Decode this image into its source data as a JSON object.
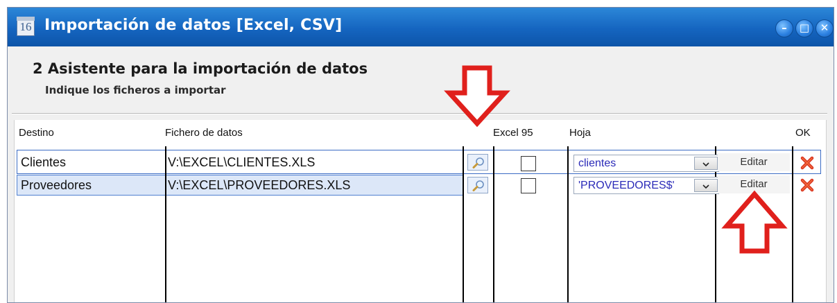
{
  "window": {
    "title": "Importación de datos [Excel, CSV]",
    "icon": "calendar-16-icon",
    "icon_text": "16",
    "controls": {
      "minimize": "–",
      "maximize": "□",
      "close": "✕"
    }
  },
  "wizard": {
    "title": "2 Asistente para la importación de datos",
    "subtitle": "Indique los ficheros a importar"
  },
  "table": {
    "headers": {
      "destino": "Destino",
      "fichero": "Fichero de datos",
      "excel95": "Excel 95",
      "hoja": "Hoja",
      "ok": "OK"
    },
    "rows": [
      {
        "destino": "Clientes",
        "fichero": "V:\\EXCEL\\CLIENTES.XLS",
        "excel95": false,
        "hoja": "clientes",
        "edit_label": "Editar"
      },
      {
        "destino": "Proveedores",
        "fichero": "V:\\EXCEL\\PROVEEDORES.XLS",
        "excel95": false,
        "hoja": "'PROVEEDORES$'",
        "edit_label": "Editar",
        "selected": true
      }
    ]
  },
  "colors": {
    "titlebar": "#1565c0",
    "annotation_arrow": "#e0201c",
    "combo_text": "#2a2ab8",
    "delete_icon": "#d8321e",
    "selected_row": "#dce7f8"
  }
}
